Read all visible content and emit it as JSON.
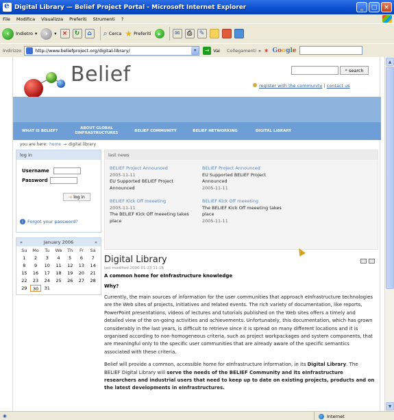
{
  "window": {
    "title": "Digital Library — Belief Project Portal - Microsoft Internet Explorer",
    "buttons": [
      "_",
      "□",
      "×"
    ]
  },
  "menubar": [
    "File",
    "Modifica",
    "Visualizza",
    "Preferiti",
    "Strumenti",
    "?"
  ],
  "toolbar": {
    "back": "Indietro",
    "search": "Cerca",
    "favorites": "Preferiti"
  },
  "addressbar": {
    "label": "Indirizzo",
    "url": "http://www.beliefproject.org/digital-library/",
    "go": "Vai",
    "links": "Collegamenti",
    "google": "Google"
  },
  "site": {
    "logo": "Belief",
    "search_button": "search",
    "register_link": "register with the community",
    "contact_link": "contact us"
  },
  "nav": [
    "WHAT IS BELIEF?",
    "ABOUT GLOBAL EINFRASTRUCTURES",
    "BELIEF COMMUNITY",
    "BELIEF NETWORKING",
    "DIGITAL LIBRARY"
  ],
  "breadcrumb": {
    "prefix": "you are here:",
    "home": "home",
    "arrow": "→",
    "current": "digital library"
  },
  "login": {
    "title": "log in",
    "username_label": "Username",
    "password_label": "Password",
    "button": "log in",
    "forgot": "Forgot your password?"
  },
  "calendar": {
    "prev": "«",
    "month": "January 2006",
    "next": "»",
    "days": [
      "Su",
      "Mo",
      "Tu",
      "We",
      "Th",
      "Fr",
      "Sa"
    ],
    "dates": [
      "1",
      "2",
      "3",
      "4",
      "5",
      "6",
      "7",
      "8",
      "9",
      "10",
      "11",
      "12",
      "13",
      "14",
      "15",
      "16",
      "17",
      "18",
      "19",
      "20",
      "21",
      "22",
      "23",
      "24",
      "25",
      "26",
      "27",
      "28",
      "29",
      "30",
      "31"
    ],
    "today": "30"
  },
  "news": {
    "title": "last news",
    "items": [
      {
        "title": "BELIEF Project Announced",
        "date": "2005-11-11",
        "body": "EU Supported BELIEF Project Announced"
      },
      {
        "title": "BELIEF Project Announced",
        "date": "2005-11-11",
        "body": "EU Supported BELIEF Project Announced"
      },
      {
        "title": "BELIEF Kick Off meeeting",
        "date": "2005-11-11",
        "body": "The BELIEF Kick Off meeeting takes place"
      },
      {
        "title": "BELIEF Kick Off meeeting",
        "date": "2005-11-11",
        "body": "The BELIEF Kick Off meeeting takes place"
      }
    ]
  },
  "content": {
    "title": "Digital Library",
    "meta": "last modified 2006-01-23 11:18",
    "description": "A common home for eInfrastructure knowledge",
    "why": "Why?",
    "paragraph1": "Currently, the main sources of information for the user communities that approach eInfrastructure technologies are the Web sites of projects, initiatives and related events. The rich variety of documentation, like reports, PowerPoint presentations, videos of lectures and tutorials published on the Web sites offers a timely and detailed view of the on-going activities and achievements. Unfortunately, this documentation, which has grown considerably in the last years, is difficult to retrieve since it is spread on many different locations and it is organised according to non-homogeneous criteria, such as project workpackages and system components, that are meaningful only to the specific user communities that are already aware of the specific semantics associated with these criteria.",
    "p2_a": "Belief will provide a common, accessible home for eInfrastructure information, in its ",
    "p2_b": "Digital Library",
    "p2_c": ". The BELIEF Digital Library will ",
    "p2_d": "serve the needs of the BELIEF Community and its eInfrastructure researchers and industrial users that need to keep up to date on existing projects, products and on the latest developments in eInfrastructures."
  },
  "statusbar": {
    "zone": "Internet"
  }
}
